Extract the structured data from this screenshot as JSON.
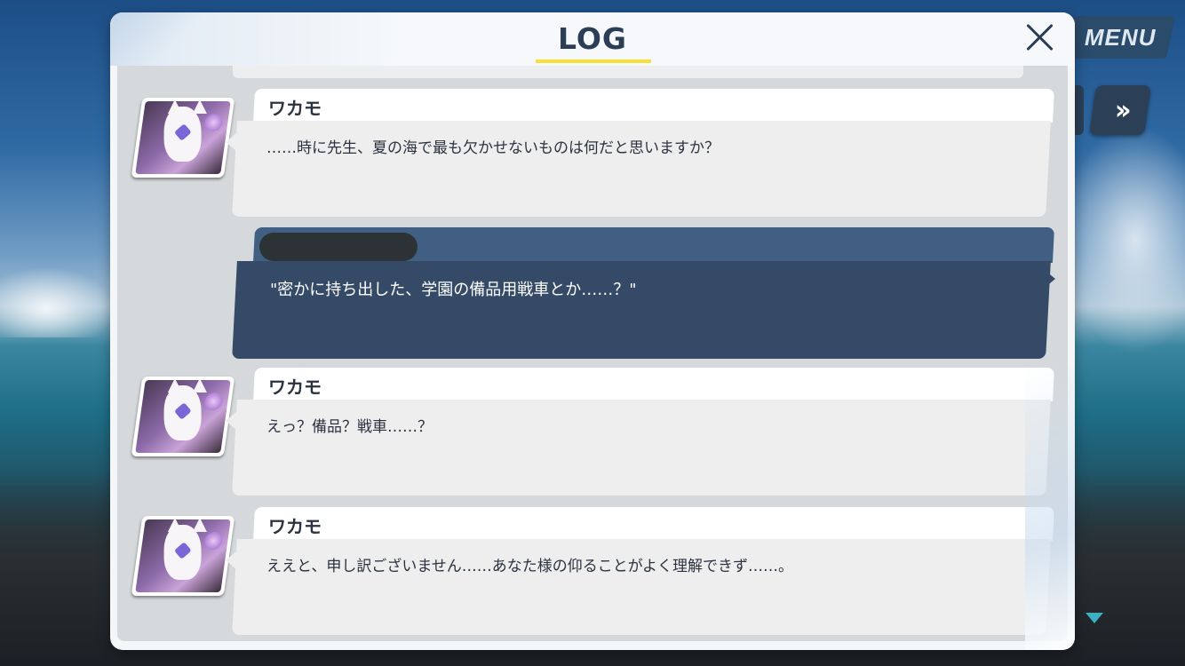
{
  "background": {
    "menu_label": "MENU",
    "fast_forward_label": "»"
  },
  "dialog": {
    "title": "LOG",
    "accent_color": "#f5e13a"
  },
  "entries": [
    {
      "speaker": "ワカモ",
      "text": "……時に先生、夏の海で最も欠かせないものは何だと思いますか？"
    },
    {
      "speaker": "",
      "text": "\"密かに持ち出した、学園の備品用戦車とか……？\""
    },
    {
      "speaker": "ワカモ",
      "text": "えっ？備品？戦車……？"
    },
    {
      "speaker": "ワカモ",
      "text": "ええと、申し訳ございません……あなた様の仰ることがよく理解できず……。"
    }
  ]
}
